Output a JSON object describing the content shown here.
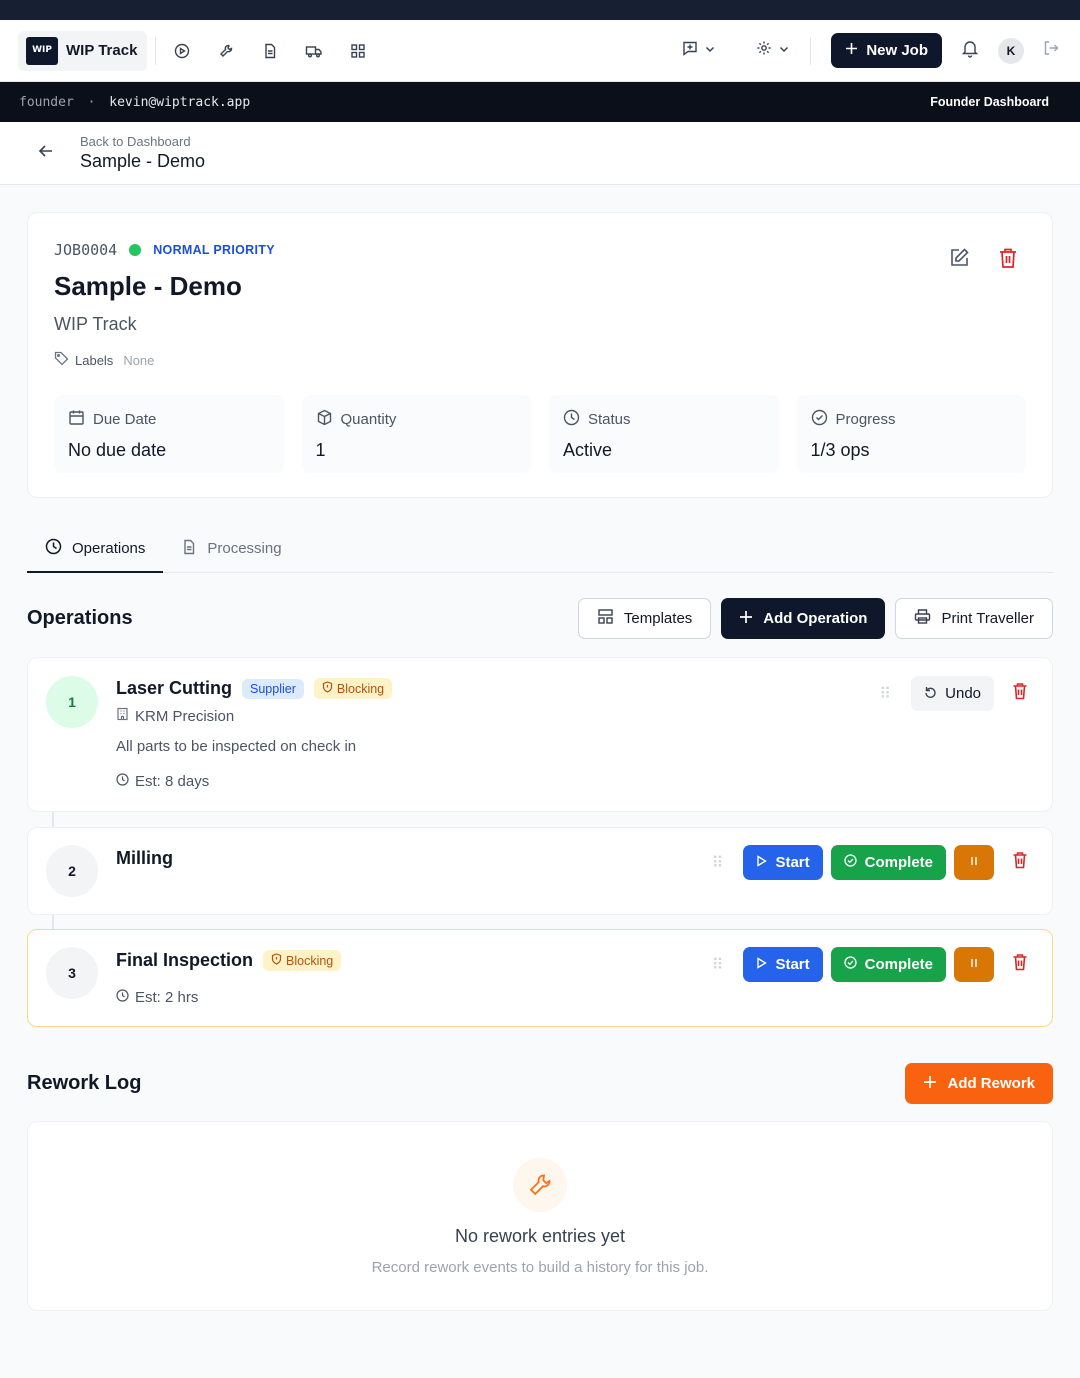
{
  "app": {
    "name": "WIP Track",
    "logo_text": "WIP",
    "new_job_label": "New Job",
    "avatar_initial": "K"
  },
  "userbar": {
    "role": "founder",
    "separator": "·",
    "email": "kevin@wiptrack.app",
    "dashboard_label": "Founder Dashboard"
  },
  "breadcrumb": {
    "back_label": "Back to Dashboard",
    "title": "Sample - Demo"
  },
  "job": {
    "id": "JOB0004",
    "priority": "NORMAL PRIORITY",
    "title": "Sample - Demo",
    "subtitle": "WIP Track",
    "labels_label": "Labels",
    "labels_value": "None",
    "stats": [
      {
        "label": "Due Date",
        "value": "No due date",
        "icon": "calendar-icon"
      },
      {
        "label": "Quantity",
        "value": "1",
        "icon": "box-icon"
      },
      {
        "label": "Status",
        "value": "Active",
        "icon": "clock-icon"
      },
      {
        "label": "Progress",
        "value": "1/3 ops",
        "icon": "check-circle-icon"
      }
    ]
  },
  "tabs": [
    {
      "label": "Operations",
      "active": true
    },
    {
      "label": "Processing",
      "active": false
    }
  ],
  "operations_section": {
    "title": "Operations",
    "templates_label": "Templates",
    "add_label": "Add Operation",
    "print_label": "Print Traveller"
  },
  "operations": [
    {
      "num": "1",
      "name": "Laser Cutting",
      "supplier_badge": "Supplier",
      "blocking_badge": "Blocking",
      "supplier": "KRM Precision",
      "note": "All parts to be inspected on check in",
      "estimate": "Est: 8 days",
      "undo_label": "Undo"
    },
    {
      "num": "2",
      "name": "Milling",
      "start_label": "Start",
      "complete_label": "Complete"
    },
    {
      "num": "3",
      "name": "Final Inspection",
      "blocking_badge": "Blocking",
      "estimate": "Est: 2 hrs",
      "start_label": "Start",
      "complete_label": "Complete"
    }
  ],
  "rework": {
    "title": "Rework Log",
    "add_label": "Add Rework",
    "empty_title": "No rework entries yet",
    "empty_sub": "Record rework events to build a history for this job."
  },
  "colors": {
    "primary_dark": "#0f172a",
    "start_blue": "#2563eb",
    "complete_green": "#16a34a",
    "pause_orange": "#d97706",
    "rework_orange": "#f9620f",
    "danger_red": "#dc2626"
  }
}
